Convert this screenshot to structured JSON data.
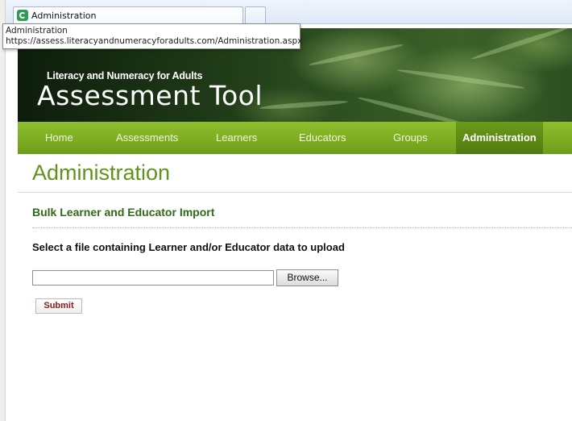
{
  "browser": {
    "tab_title": "Administration",
    "tooltip_title": "Administration",
    "tooltip_url": "https://assess.literacyandnumeracyforadults.com/Administration.aspx"
  },
  "header": {
    "brand_subtitle": "Literacy and Numeracy for Adults",
    "brand_title": "Assessment Tool"
  },
  "nav": {
    "items": [
      {
        "label": "Home"
      },
      {
        "label": "Assessments"
      },
      {
        "label": "Learners"
      },
      {
        "label": "Educators"
      },
      {
        "label": "Groups"
      },
      {
        "label": "Administration"
      }
    ],
    "active_index": 5
  },
  "main": {
    "page_title": "Administration",
    "section_title": "Bulk Learner and Educator Import",
    "instruction": "Select a file containing Learner and/or Educator data to upload",
    "file_value": "",
    "browse_label": "Browse...",
    "submit_label": "Submit"
  },
  "colors": {
    "nav_green": "#7fb024",
    "title_green": "#5f9517",
    "section_green": "#2f6a17",
    "submit_text": "#8a1c1c"
  }
}
